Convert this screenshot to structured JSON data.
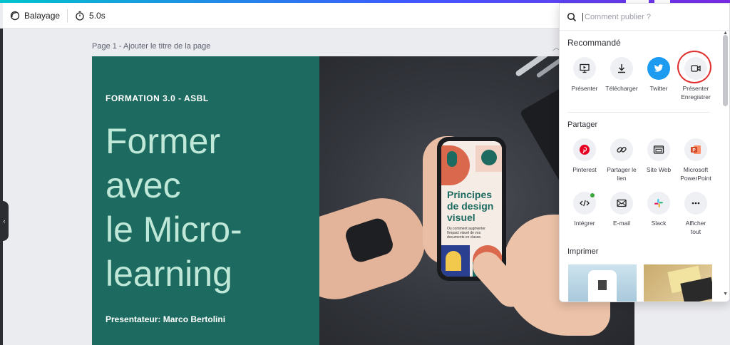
{
  "toolbar": {
    "transition_label": "Balayage",
    "duration_label": "5.0s"
  },
  "page": {
    "label": "Page 1 - Ajouter le titre de la page"
  },
  "slide": {
    "subtitle": "FORMATION 3.0 - ASBL",
    "title_lines": [
      "Former",
      "avec",
      "le Micro-",
      "learning"
    ],
    "presenter": "Presentateur: Marco Bertolini",
    "phone_title_lines": [
      "Principes",
      "de design",
      "visuel"
    ],
    "phone_small": "Ou comment augmenter l'impact visuel de vos documents  en classe."
  },
  "share_panel": {
    "search_placeholder": "Comment publier ?",
    "recommended": {
      "title": "Recommandé",
      "items": [
        {
          "label": "Présenter",
          "icon": "present-icon"
        },
        {
          "label": "Télécharger",
          "icon": "download-icon"
        },
        {
          "label": "Twitter",
          "icon": "twitter-icon"
        },
        {
          "label": "Présenter Enregistrer",
          "label_line1": "Présenter",
          "label_line2": "Enregistrer",
          "icon": "record-video-icon"
        }
      ]
    },
    "share": {
      "title": "Partager",
      "items": [
        {
          "label": "Pinterest",
          "icon": "pinterest-icon"
        },
        {
          "label": "Partager le lien",
          "label_line1": "Partager le",
          "label_line2": "lien",
          "icon": "link-icon"
        },
        {
          "label": "Site Web",
          "icon": "website-icon"
        },
        {
          "label": "Microsoft PowerPoint",
          "label_line1": "Microsoft",
          "label_line2": "PowerPoint",
          "icon": "powerpoint-icon"
        },
        {
          "label": "Intégrer",
          "icon": "embed-icon"
        },
        {
          "label": "E-mail",
          "icon": "email-icon"
        },
        {
          "label": "Slack",
          "icon": "slack-icon"
        },
        {
          "label": "Afficher tout",
          "label_line1": "Afficher",
          "label_line2": "tout",
          "icon": "more-icon"
        }
      ]
    },
    "print": {
      "title": "Imprimer"
    }
  },
  "colors": {
    "slide_green": "#1d6b60",
    "title_mint": "#bfe8d8",
    "highlight_red": "#e0302e",
    "twitter_blue": "#1d9bf0",
    "pinterest_red": "#e60023",
    "powerpoint_orange": "#d24726"
  }
}
